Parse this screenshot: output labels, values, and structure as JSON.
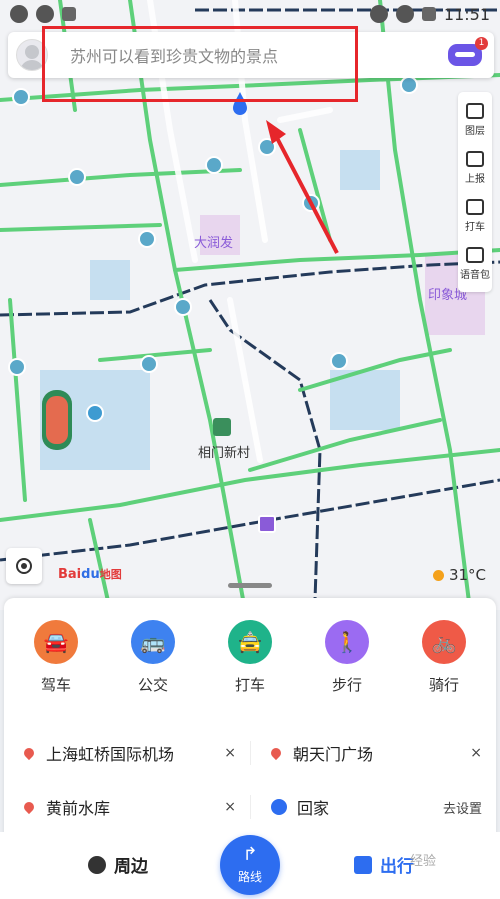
{
  "status_bar": {
    "time": "11:51"
  },
  "search": {
    "placeholder": "苏州可以看到珍贵文物的景点",
    "badge": "1"
  },
  "tools": [
    {
      "label": "图层",
      "icon": "layers-icon"
    },
    {
      "label": "上报",
      "icon": "edit-report-icon"
    },
    {
      "label": "打车",
      "icon": "taxi-icon"
    },
    {
      "label": "语音包",
      "icon": "voice-icon"
    }
  ],
  "map": {
    "labels": {
      "runfa": "大润发",
      "yinxiang": "印象城",
      "station": "相门新村"
    },
    "logo": {
      "brand": "Bai",
      "du": "du",
      "suffix": "地图"
    },
    "weather": "31°C"
  },
  "modes": [
    {
      "label": "驾车",
      "color": "#f07a3c",
      "glyph": "🚘"
    },
    {
      "label": "公交",
      "color": "#3e82f0",
      "glyph": "🚌"
    },
    {
      "label": "打车",
      "color": "#1fb38a",
      "glyph": "🚖"
    },
    {
      "label": "步行",
      "color": "#9b6bf2",
      "glyph": "🚶"
    },
    {
      "label": "骑行",
      "color": "#ef5a47",
      "glyph": "🚲"
    }
  ],
  "recents": {
    "row1": {
      "left": "上海虹桥国际机场",
      "right": "朝天门广场"
    },
    "row2": {
      "left": "黄前水库",
      "right": "回家",
      "right_action": "去设置"
    },
    "close": "×"
  },
  "nav": {
    "left": "周边",
    "center": "路线",
    "right": "出行"
  },
  "watermark": "经验"
}
